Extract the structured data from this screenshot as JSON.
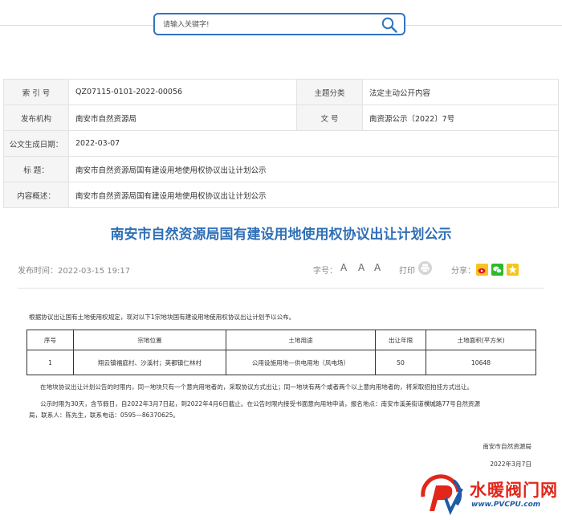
{
  "search": {
    "placeholder": "请输入关键字!"
  },
  "meta": {
    "index_label": "索 引 号",
    "index_value": "QZ07115-0101-2022-00056",
    "topic_label": "主题分类",
    "topic_value": "法定主动公开内容",
    "publisher_label": "发布机构",
    "publisher_value": "南安市自然资源局",
    "docno_label": "文  号",
    "docno_value": "南资源公示〔2022〕7号",
    "date_label": "公文生成日期：",
    "date_value": "2022-03-07",
    "title_label": "标  题：",
    "title_value": "南安市自然资源局国有建设用地使用权协议出让计划公示",
    "summary_label": "内容概述：",
    "summary_value": "南安市自然资源局国有建设用地使用权协议出让计划公示"
  },
  "article": {
    "title": "南安市自然资源局国有建设用地使用权协议出让计划公示",
    "publish_time": "发布时间：2022-03-15 19:17",
    "font_label": "字号：",
    "font_large": "A",
    "font_medium": "A",
    "font_small": "A",
    "print_label": "打印",
    "share_label": "分享：",
    "intro": "根据协议出让国有土地使用权规定，现对以下1宗地块国有建设用地使用权协议出让计划予以公布。",
    "table": {
      "headers": [
        "序号",
        "宗地位置",
        "土地用途",
        "出让年限",
        "土地面积(平方米)"
      ],
      "rows": [
        [
          "1",
          "翔云镇福庭村、沙溪村；英都镇仁林村",
          "公用设施用地—供电用地（风电场）",
          "50",
          "10648"
        ]
      ]
    },
    "para1": "在地块协议出让计划公告的时限内，同一地块只有一个意向用地者的，采取协议方式出让；同一地块有两个或者两个以上意向用地者的，将采取招拍挂方式出让。",
    "para2_line1": "公示时限为30天，含节假日，自2022年3月7日起，到2022年4月6日截止。在公告时限内接受书面意向用地申请，报名地点：南安市溪美街道樸城路77号自然资源",
    "para2_line2": "局，联系人：陈先生，联系电话：0595—86370625。",
    "sign_org": "南安市自然资源局",
    "sign_date": "2022年3月7日"
  },
  "watermark": {
    "name": "水暖阀门网",
    "url": "www.PVCPU.com"
  },
  "colors": {
    "title_blue": "#2f6fb7",
    "search_border": "#2f76c0",
    "logo_red": "#e2261a",
    "logo_blue": "#1f5aa6"
  }
}
